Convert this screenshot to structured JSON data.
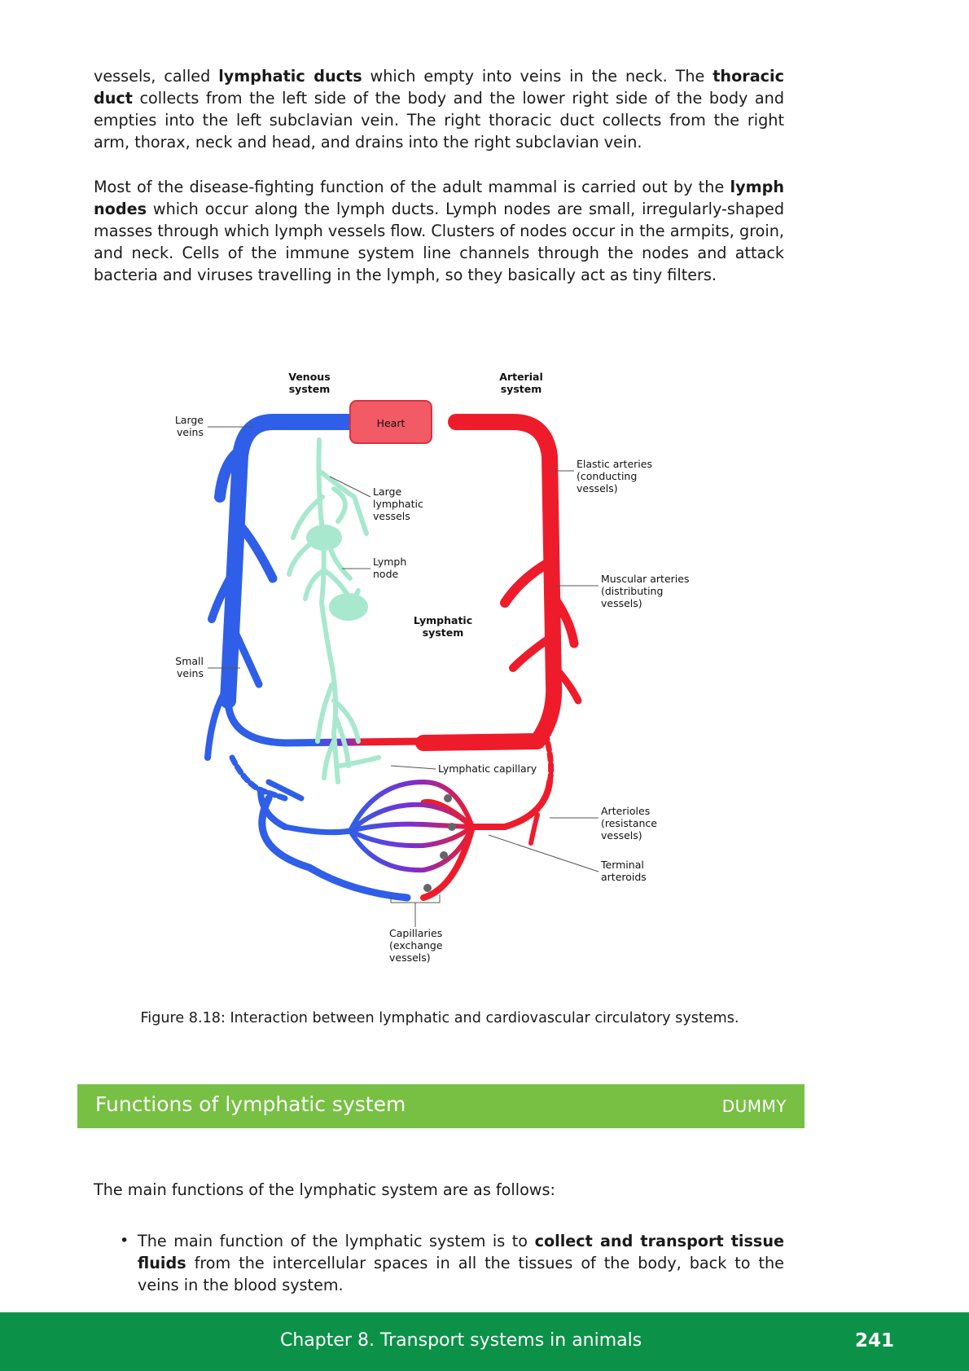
{
  "paragraphs": {
    "p1": {
      "t1": "vessels, called ",
      "b1": "lymphatic ducts",
      "t2": " which empty into veins in the neck.  The ",
      "b2": "thoracic duct",
      "t3": " collects from the left side of the body and the lower right side of the body and empties into the left subclavian vein. The right thoracic duct collects from the right arm, thorax, neck and head, and drains into the right subclavian vein."
    },
    "p2": {
      "t1": "Most of the disease-fighting function of the adult mammal is carried out by the ",
      "b1": "lymph nodes",
      "t2": " which occur along the lymph ducts.  Lymph nodes are small, irregularly-shaped masses through which lymph vessels flow. Clusters of nodes occur in the armpits, groin, and neck. Cells of the immune system line channels through the nodes and attack bacteria and viruses travelling in the lymph, so they basically act as tiny filters."
    },
    "p3": "The main functions of the lymphatic system are as follows:"
  },
  "figure": {
    "labels": {
      "venous_1": "Venous",
      "venous_2": "system",
      "arterial_1": "Arterial",
      "arterial_2": "system",
      "heart": "Heart",
      "large_veins_1": "Large",
      "large_veins_2": "veins",
      "elastic_1": "Elastic arteries",
      "elastic_2": "(conducting",
      "elastic_3": "vessels)",
      "large_lymph_1": "Large",
      "large_lymph_2": "lymphatic",
      "large_lymph_3": "vessels",
      "lymph_node_1": "Lymph",
      "lymph_node_2": "node",
      "muscular_1": "Muscular arteries",
      "muscular_2": "(distributing",
      "muscular_3": "vessels)",
      "lymphatic_system_1": "Lymphatic",
      "lymphatic_system_2": "system",
      "small_veins_1": "Small",
      "small_veins_2": "veins",
      "lymph_capillary": "Lymphatic capillary",
      "arterioles_1": "Arterioles",
      "arterioles_2": "(resistance",
      "arterioles_3": "vessels)",
      "terminal_1": "Terminal",
      "terminal_2": "arteroids",
      "capillaries_1": "Capillaries",
      "capillaries_2": "(exchange",
      "capillaries_3": "vessels)"
    },
    "caption": "Figure 8.18: Interaction between lymphatic and cardiovascular circulatory systems.",
    "colors": {
      "vein": "#2f5fe8",
      "artery": "#ee1c2b",
      "lymph": "#a8e8cf",
      "heart": "#f25a66"
    }
  },
  "section": {
    "title": "Functions of lymphatic system",
    "tag": "DUMMY",
    "color": "#77c043"
  },
  "bullets": [
    {
      "t1": "The main function of the lymphatic system is to ",
      "b1": "collect and transport tissue fluids",
      "t2": " from the intercellular spaces in all the tissues of the body, back to the veins in the blood system."
    }
  ],
  "footer": {
    "chapter": "Chapter 8.   Transport systems in animals",
    "page": "241",
    "color": "#0c9248"
  }
}
